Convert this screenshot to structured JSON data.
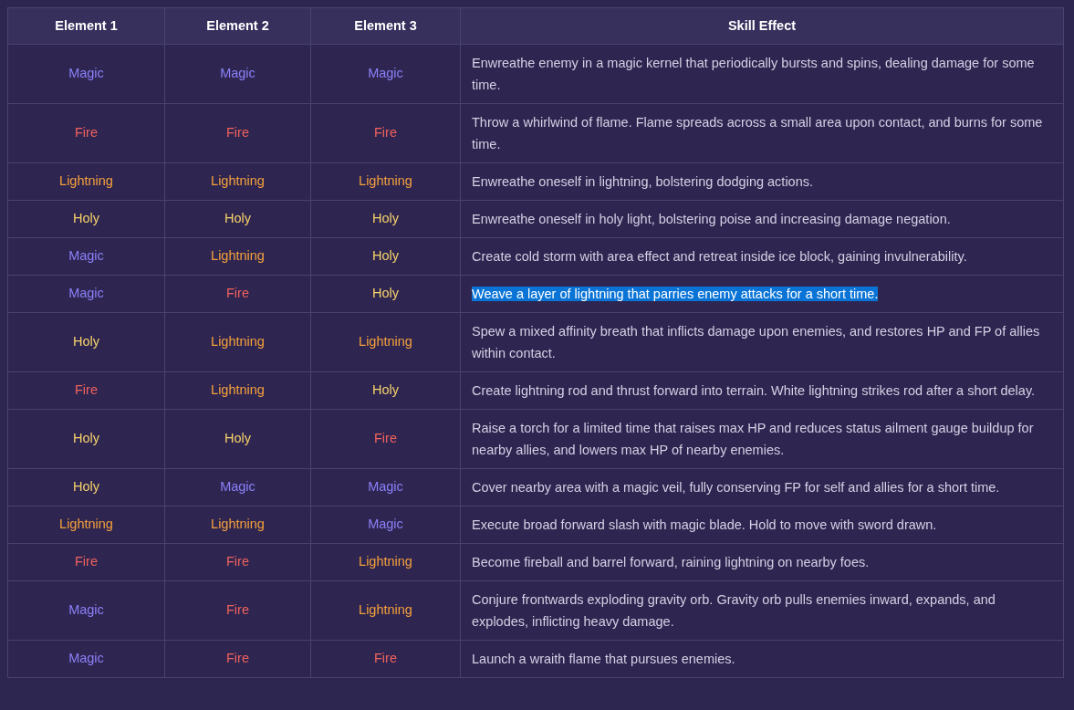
{
  "table": {
    "columns": [
      "Element 1",
      "Element 2",
      "Element 3",
      "Skill Effect"
    ],
    "rows": [
      {
        "elements": [
          {
            "name": "Magic",
            "color": "#8b80f9"
          },
          {
            "name": "Magic",
            "color": "#8b80f9"
          },
          {
            "name": "Magic",
            "color": "#8b80f9"
          }
        ],
        "effect": "Enwreathe enemy in a magic kernel that periodically bursts and spins, dealing damage for some time.",
        "selected": false
      },
      {
        "elements": [
          {
            "name": "Fire",
            "color": "#f0625d"
          },
          {
            "name": "Fire",
            "color": "#f0625d"
          },
          {
            "name": "Fire",
            "color": "#f0625d"
          }
        ],
        "effect": "Throw a whirlwind of flame. Flame spreads across a small area upon contact, and burns for some time.",
        "selected": false
      },
      {
        "elements": [
          {
            "name": "Lightning",
            "color": "#f5a03c"
          },
          {
            "name": "Lightning",
            "color": "#f5a03c"
          },
          {
            "name": "Lightning",
            "color": "#f5a03c"
          }
        ],
        "effect": "Enwreathe oneself in lightning, bolstering dodging actions.",
        "selected": false
      },
      {
        "elements": [
          {
            "name": "Holy",
            "color": "#f7d36b"
          },
          {
            "name": "Holy",
            "color": "#f7d36b"
          },
          {
            "name": "Holy",
            "color": "#f7d36b"
          }
        ],
        "effect": "Enwreathe oneself in holy light, bolstering poise and increasing damage negation.",
        "selected": false
      },
      {
        "elements": [
          {
            "name": "Magic",
            "color": "#8b80f9"
          },
          {
            "name": "Lightning",
            "color": "#f5a03c"
          },
          {
            "name": "Holy",
            "color": "#f7d36b"
          }
        ],
        "effect": "Create cold storm with area effect and retreat inside ice block, gaining invulnerability.",
        "selected": false
      },
      {
        "elements": [
          {
            "name": "Magic",
            "color": "#8b80f9"
          },
          {
            "name": "Fire",
            "color": "#f0625d"
          },
          {
            "name": "Holy",
            "color": "#f7d36b"
          }
        ],
        "effect": "Weave a layer of lightning that parries enemy attacks for a short time.",
        "selected": true
      },
      {
        "elements": [
          {
            "name": "Holy",
            "color": "#f7d36b"
          },
          {
            "name": "Lightning",
            "color": "#f5a03c"
          },
          {
            "name": "Lightning",
            "color": "#f5a03c"
          }
        ],
        "effect": "Spew a mixed affinity breath that inflicts damage upon enemies, and restores HP and FP of allies within contact.",
        "selected": false
      },
      {
        "elements": [
          {
            "name": "Fire",
            "color": "#f0625d"
          },
          {
            "name": "Lightning",
            "color": "#f5a03c"
          },
          {
            "name": "Holy",
            "color": "#f7d36b"
          }
        ],
        "effect": "Create lightning rod and thrust forward into terrain. White lightning strikes rod after a short delay.",
        "selected": false
      },
      {
        "elements": [
          {
            "name": "Holy",
            "color": "#f7d36b"
          },
          {
            "name": "Holy",
            "color": "#f7d36b"
          },
          {
            "name": "Fire",
            "color": "#f0625d"
          }
        ],
        "effect": "Raise a torch for a limited time that raises max HP and reduces status ailment gauge buildup for nearby allies, and lowers max HP of nearby enemies.",
        "selected": false
      },
      {
        "elements": [
          {
            "name": "Holy",
            "color": "#f7d36b"
          },
          {
            "name": "Magic",
            "color": "#8b80f9"
          },
          {
            "name": "Magic",
            "color": "#8b80f9"
          }
        ],
        "effect": "Cover nearby area with a magic veil, fully conserving FP for self and allies for a short time.",
        "selected": false
      },
      {
        "elements": [
          {
            "name": "Lightning",
            "color": "#f5a03c"
          },
          {
            "name": "Lightning",
            "color": "#f5a03c"
          },
          {
            "name": "Magic",
            "color": "#8b80f9"
          }
        ],
        "effect": "Execute broad forward slash with magic blade. Hold to move with sword drawn.",
        "selected": false
      },
      {
        "elements": [
          {
            "name": "Fire",
            "color": "#f0625d"
          },
          {
            "name": "Fire",
            "color": "#f0625d"
          },
          {
            "name": "Lightning",
            "color": "#f5a03c"
          }
        ],
        "effect": "Become fireball and barrel forward, raining lightning on nearby foes.",
        "selected": false
      },
      {
        "elements": [
          {
            "name": "Magic",
            "color": "#8b80f9"
          },
          {
            "name": "Fire",
            "color": "#f0625d"
          },
          {
            "name": "Lightning",
            "color": "#f5a03c"
          }
        ],
        "effect": "Conjure frontwards exploding gravity orb. Gravity orb pulls enemies inward, expands, and explodes, inflicting heavy damage.",
        "selected": false
      },
      {
        "elements": [
          {
            "name": "Magic",
            "color": "#8b80f9"
          },
          {
            "name": "Fire",
            "color": "#f0625d"
          },
          {
            "name": "Fire",
            "color": "#f0625d"
          }
        ],
        "effect": "Launch a wraith flame that pursues enemies.",
        "selected": false
      }
    ]
  }
}
